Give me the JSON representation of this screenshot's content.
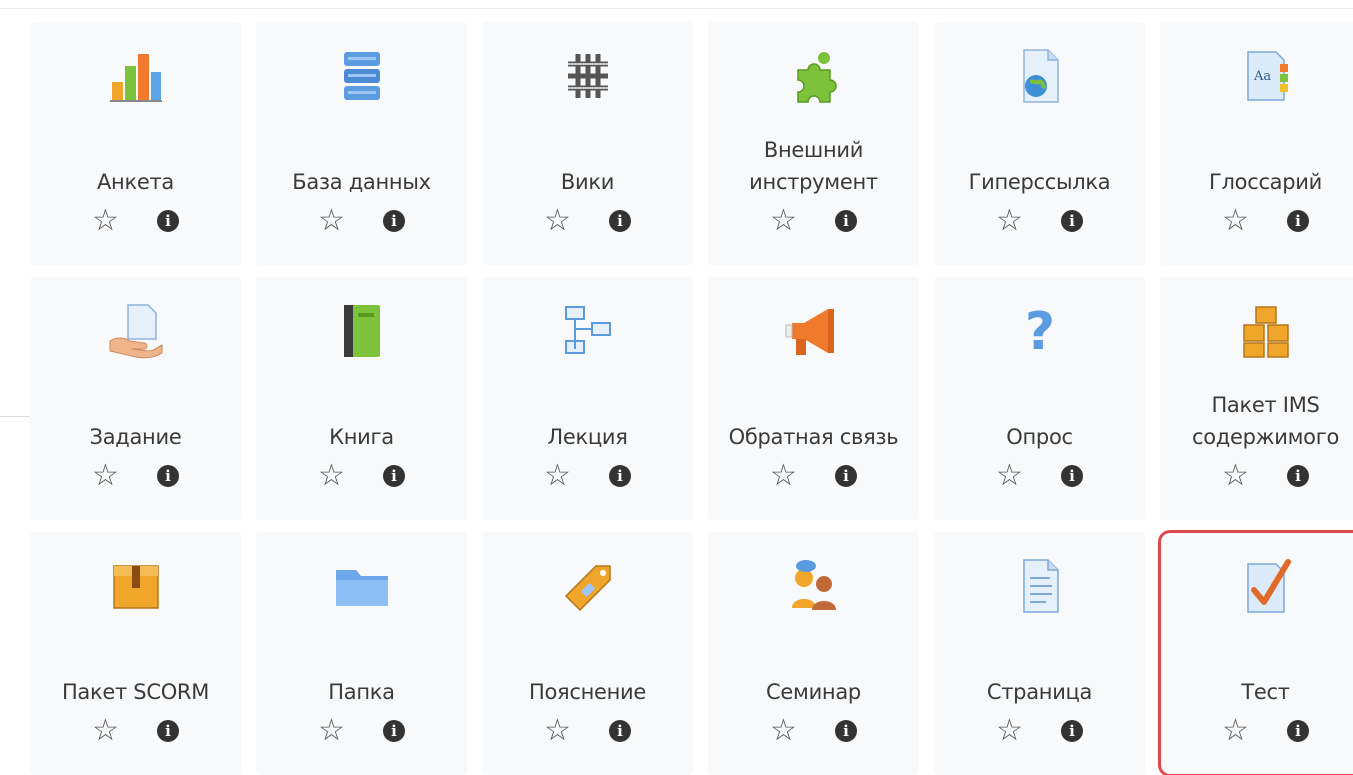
{
  "activities": [
    {
      "label_lines": [
        "Анкета"
      ],
      "icon": "bar-chart-icon"
    },
    {
      "label_lines": [
        "База данных"
      ],
      "icon": "database-icon"
    },
    {
      "label_lines": [
        "Вики"
      ],
      "icon": "wiki-icon"
    },
    {
      "label_lines": [
        "Внешний",
        "инструмент"
      ],
      "icon": "puzzle-piece-icon"
    },
    {
      "label_lines": [
        "Гиперссылка"
      ],
      "icon": "url-globe-icon"
    },
    {
      "label_lines": [
        "Глоссарий"
      ],
      "icon": "glossary-icon"
    },
    {
      "label_lines": [
        "Задание"
      ],
      "icon": "assignment-hand-icon"
    },
    {
      "label_lines": [
        "Книга"
      ],
      "icon": "book-icon"
    },
    {
      "label_lines": [
        "Лекция"
      ],
      "icon": "lesson-flow-icon"
    },
    {
      "label_lines": [
        "Обратная связь"
      ],
      "icon": "megaphone-icon"
    },
    {
      "label_lines": [
        "Опрос"
      ],
      "icon": "question-mark-icon"
    },
    {
      "label_lines": [
        "Пакет IMS",
        "содержимого"
      ],
      "icon": "package-boxes-icon"
    },
    {
      "label_lines": [
        "Пакет SCORM"
      ],
      "icon": "scorm-box-icon"
    },
    {
      "label_lines": [
        "Папка"
      ],
      "icon": "folder-icon"
    },
    {
      "label_lines": [
        "Пояснение"
      ],
      "icon": "label-tag-icon"
    },
    {
      "label_lines": [
        "Семинар"
      ],
      "icon": "workshop-people-icon"
    },
    {
      "label_lines": [
        "Страница"
      ],
      "icon": "page-icon"
    },
    {
      "label_lines": [
        "Тест"
      ],
      "icon": "quiz-check-icon",
      "highlighted": true
    }
  ],
  "action_icons": {
    "star": "☆",
    "info": "i"
  },
  "colors": {
    "highlight": "#e0474c",
    "tile_bg": "#f8f9fa",
    "text": "#3a3a3a"
  }
}
